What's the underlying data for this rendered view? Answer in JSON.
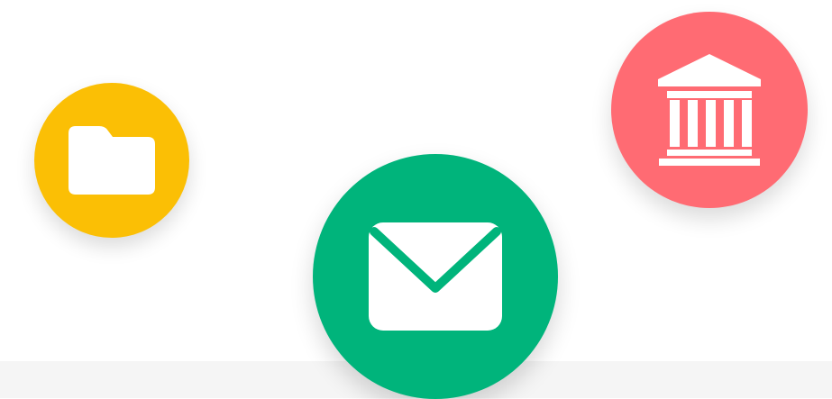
{
  "icons": [
    {
      "name": "folder",
      "color": "#fbbf05",
      "glyph_color": "#ffffff"
    },
    {
      "name": "mail",
      "color": "#00b47b",
      "glyph_color": "#ffffff"
    },
    {
      "name": "bank",
      "color": "#ff6b73",
      "glyph_color": "#ffffff"
    }
  ],
  "background": "#ffffff",
  "footer_band_color": "#f5f5f5"
}
